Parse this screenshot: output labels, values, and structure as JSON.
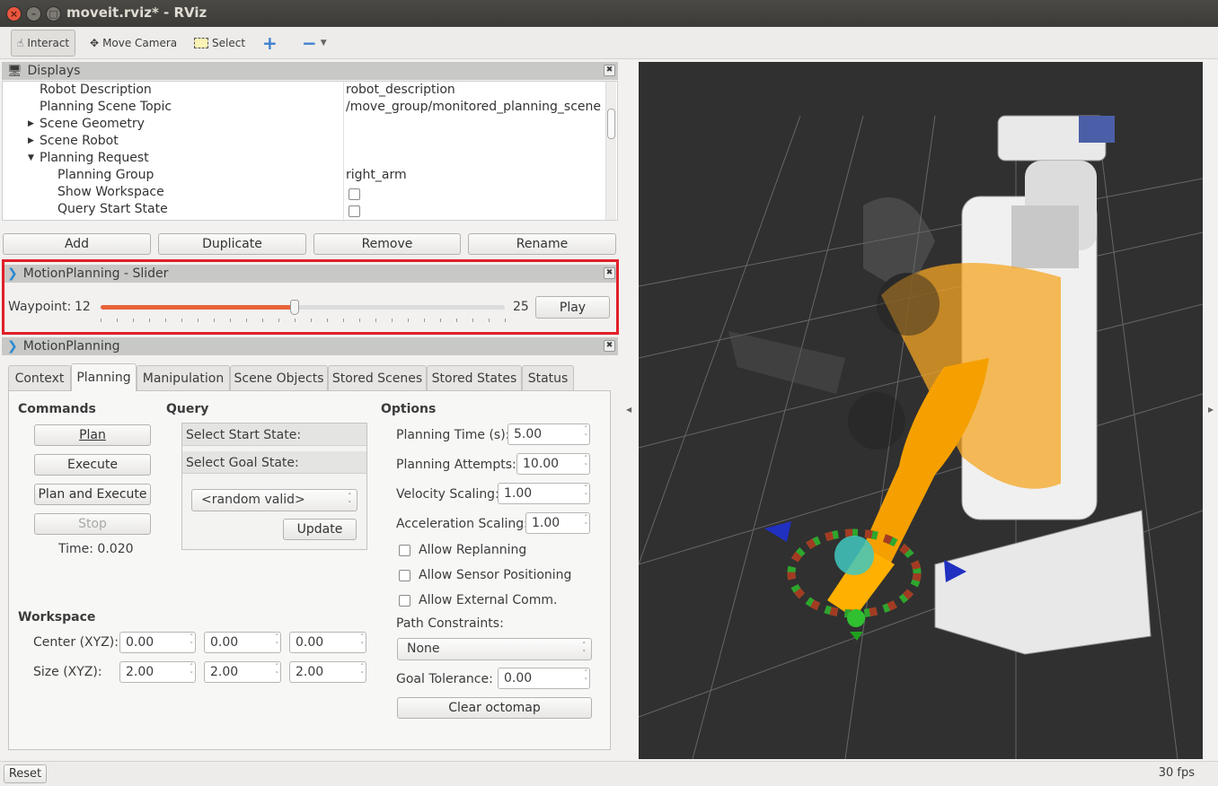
{
  "window": {
    "title": "moveit.rviz* - RViz"
  },
  "toolbar": {
    "interact": "Interact",
    "move_camera": "Move Camera",
    "select": "Select"
  },
  "displays": {
    "title": "Displays",
    "rows": [
      {
        "key": "Robot Description",
        "value": "robot_description"
      },
      {
        "key": "Planning Scene Topic",
        "value": "/move_group/monitored_planning_scene"
      },
      {
        "key": "Scene Geometry",
        "value": ""
      },
      {
        "key": "Scene Robot",
        "value": ""
      },
      {
        "key": "Planning Request",
        "value": ""
      },
      {
        "key": "Planning Group",
        "value": "right_arm"
      },
      {
        "key": "Show Workspace",
        "value": ""
      },
      {
        "key": "Query Start State",
        "value": ""
      }
    ],
    "buttons": {
      "add": "Add",
      "duplicate": "Duplicate",
      "remove": "Remove",
      "rename": "Rename"
    }
  },
  "slider_panel": {
    "title": "MotionPlanning - Slider",
    "label": "Waypoint:",
    "current": "12",
    "max": "25",
    "play": "Play",
    "position_fraction": 0.48
  },
  "motion_planning": {
    "title": "MotionPlanning",
    "tabs": [
      "Context",
      "Planning",
      "Manipulation",
      "Scene Objects",
      "Stored Scenes",
      "Stored States",
      "Status"
    ],
    "active_tab": "Planning",
    "commands": {
      "heading": "Commands",
      "plan": "Plan",
      "execute": "Execute",
      "plan_execute": "Plan and Execute",
      "stop": "Stop",
      "time": "Time: 0.020"
    },
    "query": {
      "heading": "Query",
      "start": "Select Start State:",
      "goal": "Select Goal State:",
      "goal_value": "<random valid>",
      "update": "Update"
    },
    "options": {
      "heading": "Options",
      "planning_time_label": "Planning Time (s):",
      "planning_time": "5.00",
      "attempts_label": "Planning Attempts:",
      "attempts": "10.00",
      "velocity_label": "Velocity Scaling:",
      "velocity": "1.00",
      "accel_label": "Acceleration Scaling:",
      "accel": "1.00",
      "replanning": "Allow Replanning",
      "sensor": "Allow Sensor Positioning",
      "external": "Allow External Comm.",
      "path_label": "Path Constraints:",
      "path_value": "None",
      "tolerance_label": "Goal Tolerance:",
      "tolerance": "0.00",
      "clear": "Clear octomap"
    },
    "workspace": {
      "heading": "Workspace",
      "center_label": "Center (XYZ):",
      "center": [
        "0.00",
        "0.00",
        "0.00"
      ],
      "size_label": "Size (XYZ):",
      "size": [
        "2.00",
        "2.00",
        "2.00"
      ]
    }
  },
  "status": {
    "reset": "Reset",
    "fps": "30 fps"
  },
  "colors": {
    "highlight": "#e0202a",
    "slider_fill": "#e8643a",
    "viewport_bg": "#303030"
  }
}
